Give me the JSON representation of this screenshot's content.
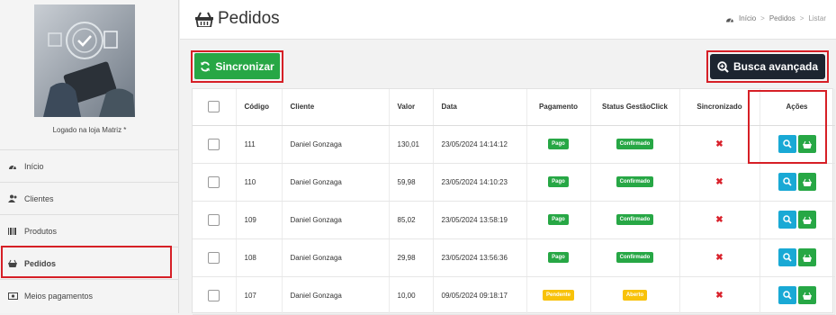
{
  "sidebar": {
    "logged_text": "Logado na loja Matriz *",
    "items": [
      {
        "label": "Início",
        "icon": "dashboard-icon"
      },
      {
        "label": "Clientes",
        "icon": "users-icon"
      },
      {
        "label": "Produtos",
        "icon": "barcode-icon"
      },
      {
        "label": "Pedidos",
        "icon": "basket-icon"
      },
      {
        "label": "Meios pagamentos",
        "icon": "money-icon"
      }
    ]
  },
  "header": {
    "title": "Pedidos",
    "breadcrumb": [
      "Início",
      "Pedidos",
      "Listar"
    ]
  },
  "toolbar": {
    "sync_label": "Sincronizar",
    "search_label": "Busca avançada"
  },
  "table": {
    "columns": [
      "Código",
      "Cliente",
      "Valor",
      "Data",
      "Pagamento",
      "Status GestãoClick",
      "Sincronizado",
      "Ações"
    ],
    "rows": [
      {
        "codigo": "111",
        "cliente": "Daniel Gonzaga",
        "valor": "130,01",
        "data": "23/05/2024 14:14:12",
        "pagamento": "Pago",
        "status": "Confirmado"
      },
      {
        "codigo": "110",
        "cliente": "Daniel Gonzaga",
        "valor": "59,98",
        "data": "23/05/2024 14:10:23",
        "pagamento": "Pago",
        "status": "Confirmado"
      },
      {
        "codigo": "109",
        "cliente": "Daniel Gonzaga",
        "valor": "85,02",
        "data": "23/05/2024 13:58:19",
        "pagamento": "Pago",
        "status": "Confirmado"
      },
      {
        "codigo": "108",
        "cliente": "Daniel Gonzaga",
        "valor": "29,98",
        "data": "23/05/2024 13:56:36",
        "pagamento": "Pago",
        "status": "Confirmado"
      },
      {
        "codigo": "107",
        "cliente": "Daniel Gonzaga",
        "valor": "10,00",
        "data": "09/05/2024 09:18:17",
        "pagamento": "Pendente",
        "status": "Aberto"
      }
    ],
    "sync_mark": "✖"
  },
  "colors": {
    "green": "#27a745",
    "dark": "#1d2530",
    "blue": "#19a9d5",
    "yellow": "#f8c20a",
    "red": "#d9232d",
    "highlight": "#d61f26"
  }
}
